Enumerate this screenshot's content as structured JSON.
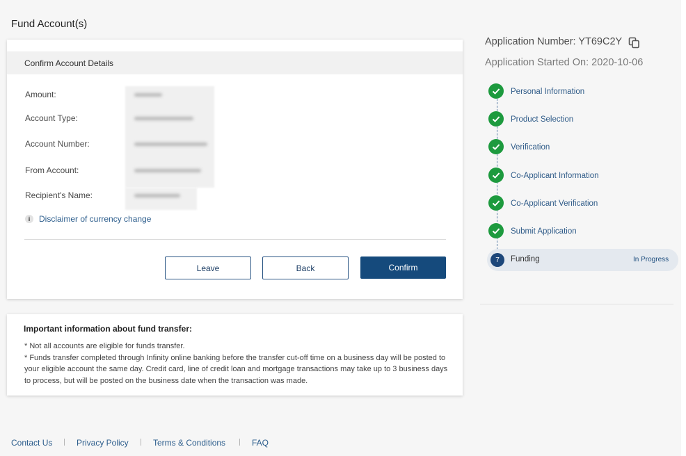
{
  "page": {
    "title": "Fund Account(s)"
  },
  "confirm_card": {
    "header": "Confirm Account Details",
    "fields": [
      {
        "label": "Amount:"
      },
      {
        "label": "Account Type:"
      },
      {
        "label": "Account Number:"
      },
      {
        "label": "From Account:"
      },
      {
        "label": "Recipient's Name:"
      }
    ],
    "disclaimer": {
      "icon": "info-icon",
      "label": "Disclaimer of currency change"
    },
    "buttons": {
      "leave": "Leave",
      "back": "Back",
      "confirm": "Confirm"
    }
  },
  "info_card": {
    "title": "Important information about fund transfer:",
    "items": [
      "* Not all accounts are eligible for funds transfer.",
      "* Funds transfer completed through Infinity online banking before the transfer cut-off time on a business day will be posted to your eligible account the same day. Credit card, line of credit loan and mortgage transactions may take up to 3 business days to process, but will be posted on the business date when the transaction was made."
    ]
  },
  "footer": {
    "links": [
      "Contact Us",
      "Privacy Policy",
      "Terms & Conditions",
      "FAQ"
    ]
  },
  "sidebar": {
    "application_number": "Application Number: YT69C2Y",
    "copy_icon": "copy-icon",
    "started_on": "Application Started On: 2020-10-06",
    "steps": [
      {
        "label": "Personal Information",
        "icon": "check-circle-icon"
      },
      {
        "label": "Product Selection",
        "icon": "check-circle-icon"
      },
      {
        "label": "Verification",
        "icon": "check-circle-icon"
      },
      {
        "label": "Co-Applicant Information",
        "icon": "check-circle-icon"
      },
      {
        "label": "Co-Applicant Verification",
        "icon": "check-circle-icon"
      },
      {
        "label": "Submit Application",
        "icon": "check-circle-icon"
      },
      {
        "number": "7",
        "label": "Funding",
        "status": "In Progress"
      }
    ]
  },
  "colors": {
    "primary": "#154a7c",
    "link": "#2c5d8c",
    "complete": "#1d9a3e",
    "current_step_bg": "#e4e9ef",
    "page_bg": "#f6f6f6"
  }
}
